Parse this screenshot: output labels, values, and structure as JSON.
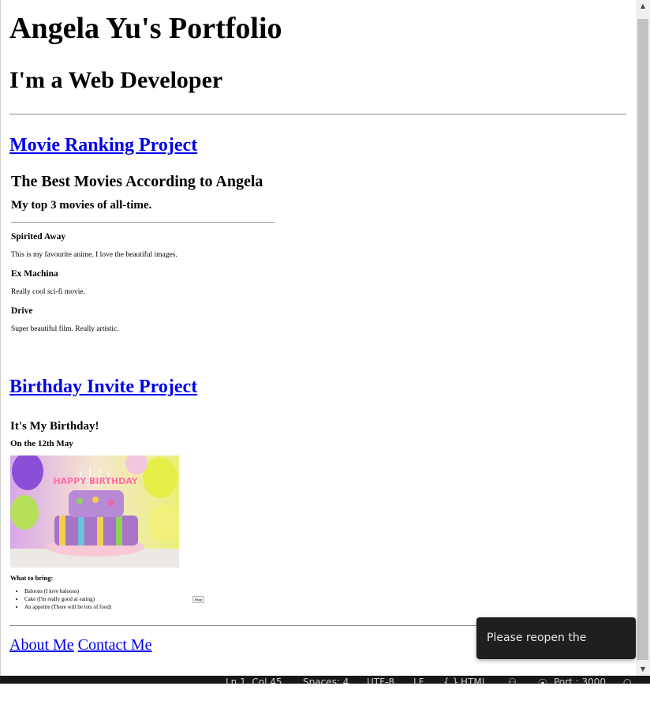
{
  "page": {
    "title": "Angela Yu's Portfolio",
    "subtitle": "I'm a Web Developer"
  },
  "projects": [
    {
      "link_label": "Movie Ranking Project",
      "preview": {
        "heading": "The Best Movies According to Angela",
        "subheading": "My top 3 movies of all-time.",
        "movies": [
          {
            "title": "Spirited Away",
            "desc": "This is my favourite anime. I love the beautiful images."
          },
          {
            "title": "Ex Machina",
            "desc": "Really cool sci-fi movie."
          },
          {
            "title": "Drive",
            "desc": "Super beautiful film. Really artistic."
          }
        ]
      }
    },
    {
      "link_label": "Birthday Invite Project",
      "preview": {
        "heading": "It's My Birthday!",
        "date": "On the 12th May",
        "cake_text": "HAPPY BIRTHDAY",
        "bring_heading": "What to bring:",
        "items": [
          "Baloons (I love baloons)",
          "Cake (I'm really good at eating)",
          "An appetite (There will be lots of food)"
        ],
        "rsvp": "Rsvp"
      }
    }
  ],
  "footer": {
    "about": "About Me",
    "contact": "Contact Me"
  },
  "toast": {
    "message": "Please reopen the preview."
  },
  "statusbar": {
    "position": "Ln 1, Col 45",
    "spaces": "Spaces: 4",
    "encoding": "UTF-8",
    "eol": "LF",
    "language": "HTML",
    "port": "Port : 3000"
  },
  "colors": {
    "link": "#0000ee",
    "toast_bg": "#1f1f1f",
    "statusbar_bg": "#181818"
  }
}
